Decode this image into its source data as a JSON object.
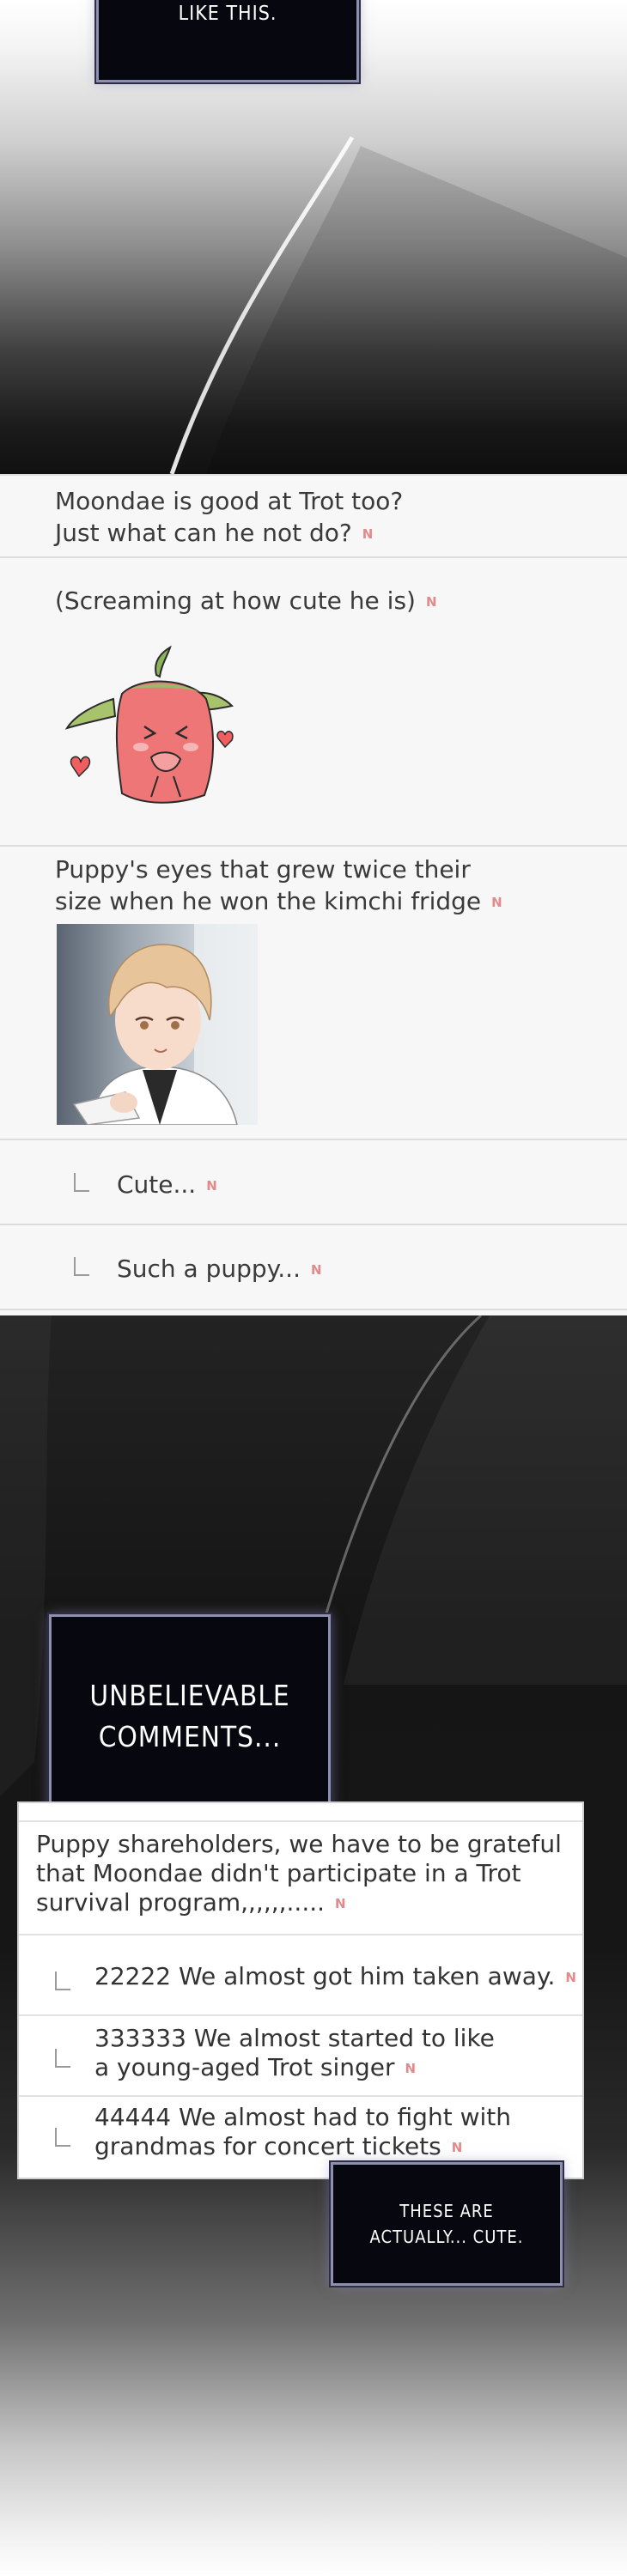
{
  "captions": {
    "top": "LIKE THIS.",
    "middle_line1": "UNBELIEVABLE",
    "middle_line2": "COMMENTS...",
    "bottom_line1": "THESE ARE",
    "bottom_line2": "ACTUALLY... CUTE."
  },
  "badge": "N",
  "comments": [
    {
      "lines": [
        "Moondae is good at Trot too?",
        "Just what can he not do?"
      ]
    },
    {
      "lines": [
        "(Screaming at how cute he is)"
      ]
    },
    {
      "lines": [
        "Puppy's eyes that grew twice their",
        "size when he won the kimchi fridge"
      ]
    },
    {
      "lines": [
        "Cute..."
      ]
    },
    {
      "lines": [
        "Such a puppy..."
      ]
    }
  ],
  "card_comments": [
    {
      "lines": [
        "Puppy shareholders, we have to be grateful",
        "that Moondae didn't participate in a Trot",
        "survival program,,,,,,....."
      ]
    },
    {
      "lines": [
        "22222 We almost got him taken away."
      ]
    },
    {
      "lines": [
        "333333 We almost started to like",
        "a young-aged Trot singer"
      ]
    },
    {
      "lines": [
        "44444 We almost had to fight with",
        "grandmas for concert tickets"
      ]
    }
  ],
  "colors": {
    "badge": "#e48a8a",
    "caption_bg": "#07070f",
    "caption_border": "#8f8fb0",
    "sticker_pink": "#f08080",
    "sticker_green": "#9cb86a"
  },
  "icons": [
    "reply-arrow-icon",
    "strawberry-sticker",
    "heart-icon"
  ]
}
